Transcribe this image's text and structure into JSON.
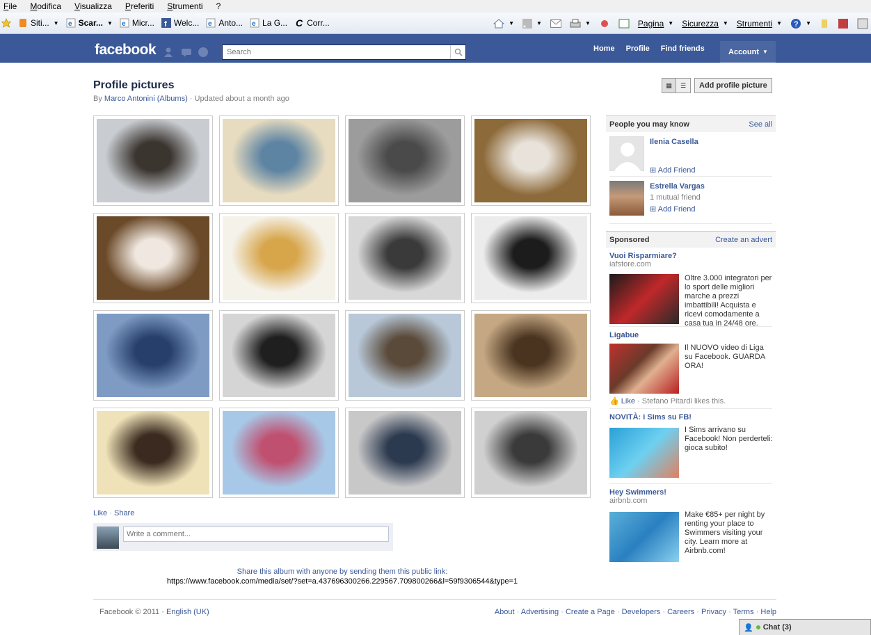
{
  "browser": {
    "menu": [
      "File",
      "Modifica",
      "Visualizza",
      "Preferiti",
      "Strumenti",
      "?"
    ],
    "favorites": [
      {
        "label": "Siti...",
        "icon": "star-add-icon"
      },
      {
        "label": "Siti...",
        "icon": "suggested-sites-icon"
      },
      {
        "label": "Scar...",
        "icon": "ie-icon"
      },
      {
        "label": "Micr...",
        "icon": "ie-icon"
      },
      {
        "label": "Welc...",
        "icon": "facebook-icon"
      },
      {
        "label": "Anto...",
        "icon": "ie-icon"
      },
      {
        "label": "La G...",
        "icon": "ie-icon"
      },
      {
        "label": "Corr...",
        "icon": "c-icon"
      }
    ],
    "tools": [
      "Pagina",
      "Sicurezza",
      "Strumenti"
    ]
  },
  "fb": {
    "logo": "facebook",
    "search_placeholder": "Search",
    "nav": [
      "Home",
      "Profile",
      "Find friends",
      "Account"
    ]
  },
  "album": {
    "title": "Profile pictures",
    "by": "By",
    "owner": "Marco Antonini",
    "albums_link": "(Albums)",
    "updated": "· Updated about a month ago",
    "add_button": "Add profile picture",
    "photos": [
      {
        "c1": "#c9cdd2",
        "c2": "#3b3530"
      },
      {
        "c1": "#e8dcc0",
        "c2": "#5d84a3"
      },
      {
        "c1": "#9c9c9c",
        "c2": "#4a4a4a"
      },
      {
        "c1": "#8d6a3a",
        "c2": "#e8e2da"
      },
      {
        "c1": "#6b4a2a",
        "c2": "#f0e8e0"
      },
      {
        "c1": "#f5f2ea",
        "c2": "#d7a54a"
      },
      {
        "c1": "#d8d8d8",
        "c2": "#3a3a3a"
      },
      {
        "c1": "#ececec",
        "c2": "#1c1c1c"
      },
      {
        "c1": "#7e9bc4",
        "c2": "#27406b"
      },
      {
        "c1": "#d5d5d5",
        "c2": "#1f1f1f"
      },
      {
        "c1": "#b8c8d8",
        "c2": "#5a4a3a"
      },
      {
        "c1": "#c5a883",
        "c2": "#4a3420"
      },
      {
        "c1": "#efe2b8",
        "c2": "#3a2a20"
      },
      {
        "c1": "#a8c8e8",
        "c2": "#c05070"
      },
      {
        "c1": "#c8c8c8",
        "c2": "#2c3a50"
      },
      {
        "c1": "#d0d0d0",
        "c2": "#3a3a3a"
      }
    ],
    "like": "Like",
    "share": "Share",
    "comment_placeholder": "Write a comment...",
    "share_text": "Share this album with anyone by sending them this public link:",
    "share_url": "https://www.facebook.com/media/set/?set=a.437696300266.229567.709800266&l=59f9306544&type=1"
  },
  "sidebar": {
    "pymk_title": "People you may know",
    "see_all": "See all",
    "people": [
      {
        "name": "Ilenia Casella",
        "mutual": "",
        "add": "Add Friend"
      },
      {
        "name": "Estrella Vargas",
        "mutual": "1 mutual friend",
        "add": "Add Friend"
      }
    ],
    "sponsored": "Sponsored",
    "create_advert": "Create an advert",
    "ads": [
      {
        "title": "Vuoi Risparmiare?",
        "url": "iafstore.com",
        "text": "Oltre 3.000 integratori per lo sport delle migliori marche a prezzi imbattibili! Acquista e ricevi comodamente a casa tua in 24/48 ore.",
        "like": "",
        "likes": ""
      },
      {
        "title": "Ligabue",
        "url": "",
        "text": "Il NUOVO video di Liga su Facebook. GUARDA ORA!",
        "like": "Like",
        "likes": "· Stefano Pitardi likes this."
      },
      {
        "title": "NOVITÀ: i Sims su FB!",
        "url": "",
        "text": "I Sims arrivano su Facebook! Non perderteli: gioca subito!",
        "like": "",
        "likes": ""
      },
      {
        "title": "Hey Swimmers!",
        "url": "airbnb.com",
        "text": "Make €85+ per night by renting your place to Swimmers visiting your city. Learn more at Airbnb.com!",
        "like": "",
        "likes": ""
      }
    ]
  },
  "footer": {
    "copyright": "Facebook © 2011",
    "sep": "·",
    "language": "English (UK)",
    "links": [
      "About",
      "Advertising",
      "Create a Page",
      "Developers",
      "Careers",
      "Privacy",
      "Terms",
      "Help"
    ]
  },
  "chat": {
    "label": "Chat (3)"
  }
}
